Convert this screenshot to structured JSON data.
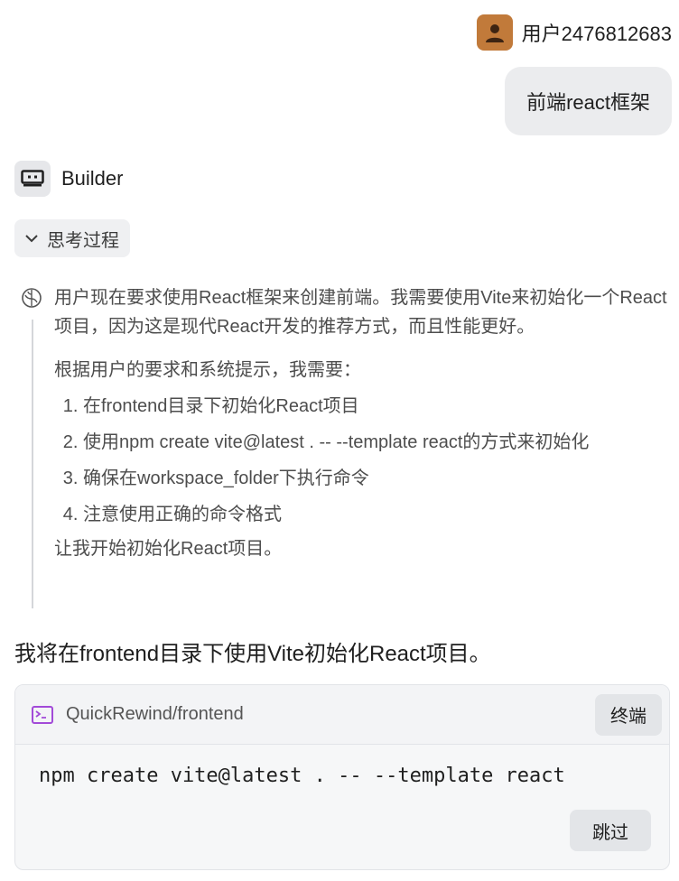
{
  "user": {
    "name": "用户2476812683",
    "message": "前端react框架"
  },
  "bot": {
    "name": "Builder"
  },
  "thinking": {
    "toggle_label": "思考过程",
    "para1": "用户现在要求使用React框架来创建前端。我需要使用Vite来初始化一个React项目，因为这是现代React开发的推荐方式，而且性能更好。",
    "para2": "根据用户的要求和系统提示，我需要：",
    "steps": [
      "在frontend目录下初始化React项目",
      "使用npm create vite@latest . -- --template react的方式来初始化",
      "确保在workspace_folder下执行命令",
      "注意使用正确的命令格式"
    ],
    "para3": "让我开始初始化React项目。"
  },
  "answer": "我将在frontend目录下使用Vite初始化React项目。",
  "terminal": {
    "path": "QuickRewind/frontend",
    "terminal_button": "终端",
    "command": "npm create vite@latest . -- --template react",
    "skip_button": "跳过"
  }
}
